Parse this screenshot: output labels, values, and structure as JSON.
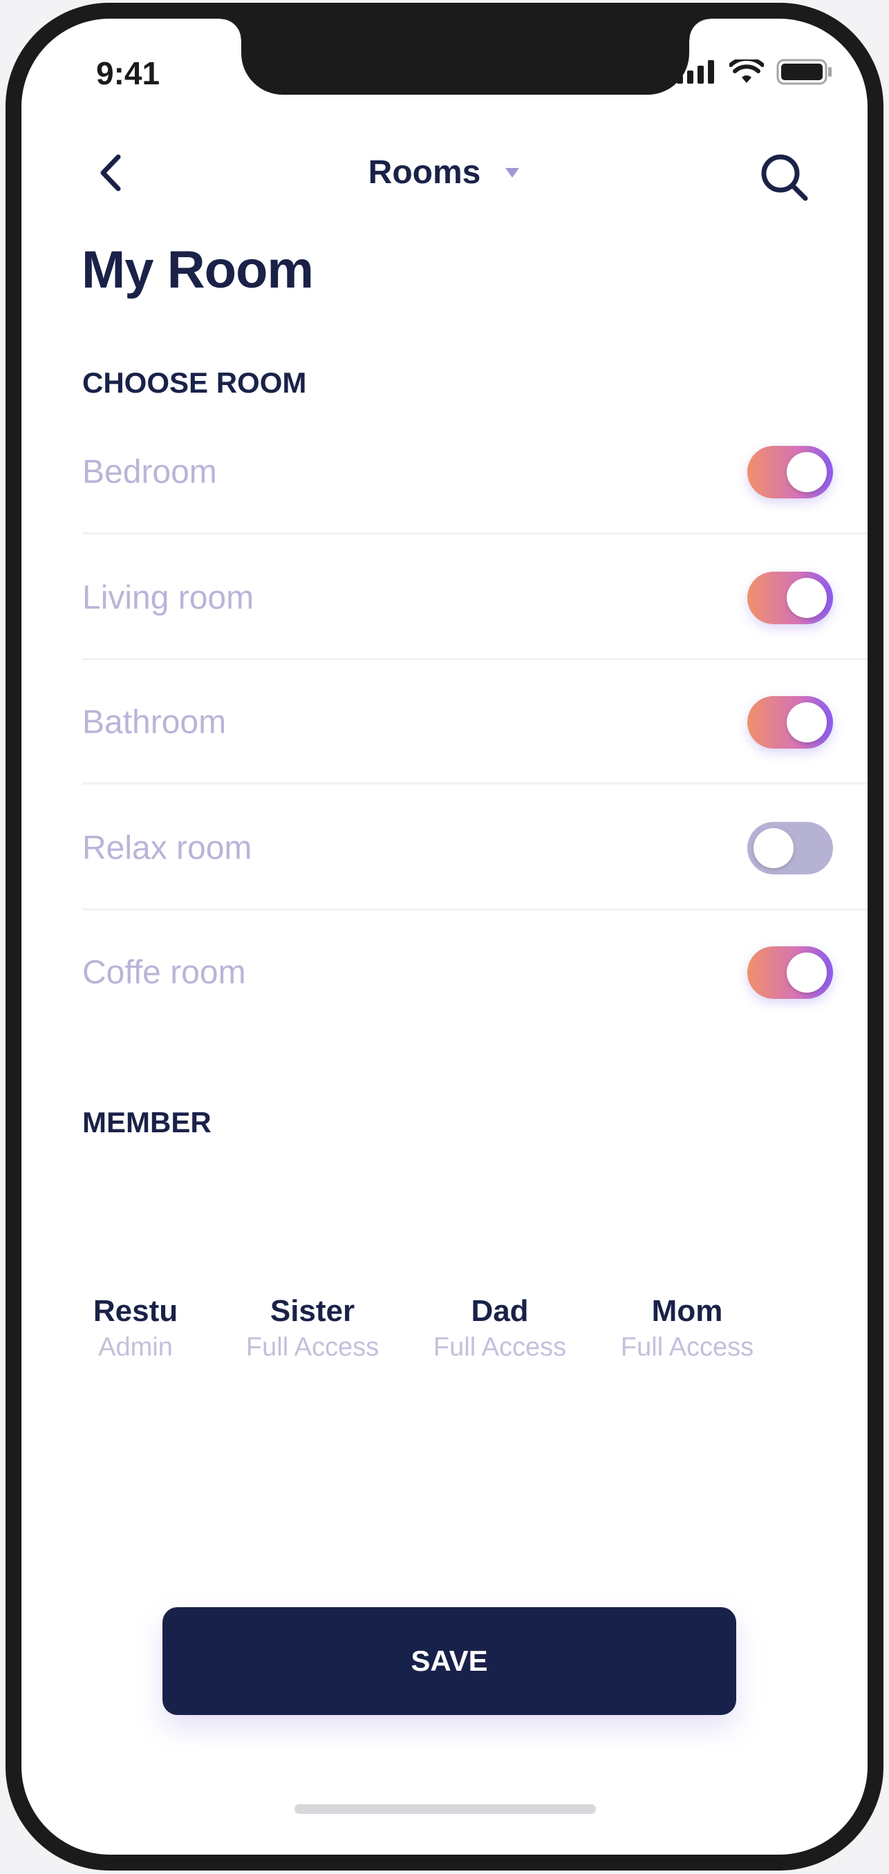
{
  "status_bar": {
    "time": "9:41"
  },
  "nav": {
    "title": "Rooms",
    "back_icon": "chevron-left-icon",
    "search_icon": "search-icon",
    "dropdown_icon": "caret-down-icon"
  },
  "page_title": "My Room",
  "rooms_section": {
    "label": "CHOOSE ROOM",
    "rooms": [
      {
        "label": "Bedroom",
        "enabled": true
      },
      {
        "label": "Living room",
        "enabled": true
      },
      {
        "label": "Bathroom",
        "enabled": true
      },
      {
        "label": "Relax room",
        "enabled": false
      },
      {
        "label": "Coffe room",
        "enabled": true
      }
    ]
  },
  "members_section": {
    "label": "MEMBER",
    "members": [
      {
        "name": "Restu",
        "role": "Admin"
      },
      {
        "name": "Sister",
        "role": "Full Access"
      },
      {
        "name": "Dad",
        "role": "Full Access"
      },
      {
        "name": "Mom",
        "role": "Full Access"
      }
    ]
  },
  "save_button": {
    "label": "SAVE"
  },
  "colors": {
    "primary": "#182149",
    "muted_text": "#b9b5d8",
    "toggle_start": "#f1906a",
    "toggle_end": "#8a5cf0",
    "toggle_off": "#b6b2d4"
  }
}
